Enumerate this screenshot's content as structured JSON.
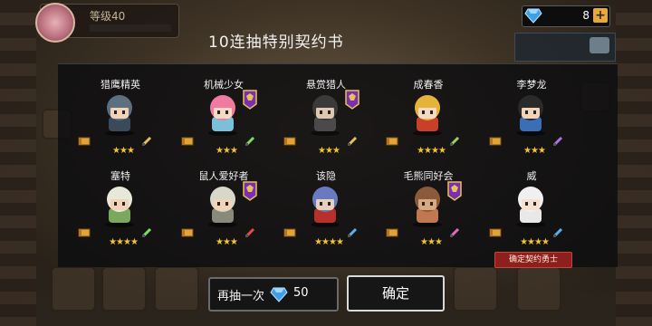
{
  "player": {
    "level": "等级40"
  },
  "currency": {
    "gems": "8"
  },
  "title": "10连抽特别契约书",
  "heroes": [
    {
      "name": "猎鹰精英",
      "stars": "★★★",
      "elite": false,
      "hair": "#5d7080",
      "skin": "#f1d3b8",
      "cloth": "#3b4a5a",
      "weapon": "#e8c05a"
    },
    {
      "name": "机械少女",
      "stars": "★★★",
      "elite": true,
      "hair": "#f07aa0",
      "skin": "#f6d9c4",
      "cloth": "#7ac0d8",
      "weapon": "#7be060"
    },
    {
      "name": "悬赏猎人",
      "stars": "★★★",
      "elite": true,
      "hair": "#3a3a3a",
      "skin": "#e0c7b0",
      "cloth": "#4a4a4a",
      "weapon": "#e8c05a"
    },
    {
      "name": "成春香",
      "stars": "★★★★",
      "elite": false,
      "hair": "#e6b33a",
      "skin": "#f6d9c4",
      "cloth": "#c8402a",
      "weapon": "#9ad060"
    },
    {
      "name": "李梦龙",
      "stars": "★★★",
      "elite": false,
      "hair": "#2a2a2a",
      "skin": "#f1d3b8",
      "cloth": "#3a6fb8",
      "weapon": "#b070e0"
    },
    {
      "name": "塞特",
      "stars": "★★★★",
      "elite": false,
      "hair": "#e8e8d8",
      "skin": "#f1d3b8",
      "cloth": "#7aa860",
      "weapon": "#7be060"
    },
    {
      "name": "鼠人爱好者",
      "stars": "★★★",
      "elite": true,
      "hair": "#d8d8c8",
      "skin": "#f1d3b8",
      "cloth": "#8a8a7a",
      "weapon": "#e84a4a"
    },
    {
      "name": "该隐",
      "stars": "★★★★",
      "elite": false,
      "hair": "#6a7ac0",
      "skin": "#e6d0bc",
      "cloth": "#b8302a",
      "weapon": "#5ab0e8"
    },
    {
      "name": "毛熊同好会",
      "stars": "★★★",
      "elite": true,
      "hair": "#8a5a3a",
      "skin": "#d8a880",
      "cloth": "#c07850",
      "weapon": "#e868c0"
    },
    {
      "name": "威",
      "stars": "★★★★",
      "elite": false,
      "hair": "#f0f0f0",
      "skin": "#f6e0d0",
      "cloth": "#e8e8e8",
      "weapon": "#5ab0e8"
    }
  ],
  "confirm_tag": "确定契约勇士",
  "again": {
    "label": "再抽一次",
    "cost": "50"
  },
  "ok_label": "确定",
  "colors": {
    "gem": "#3fa0e8",
    "star": "#f2c230",
    "elite_badge": "#7a2fb0"
  }
}
